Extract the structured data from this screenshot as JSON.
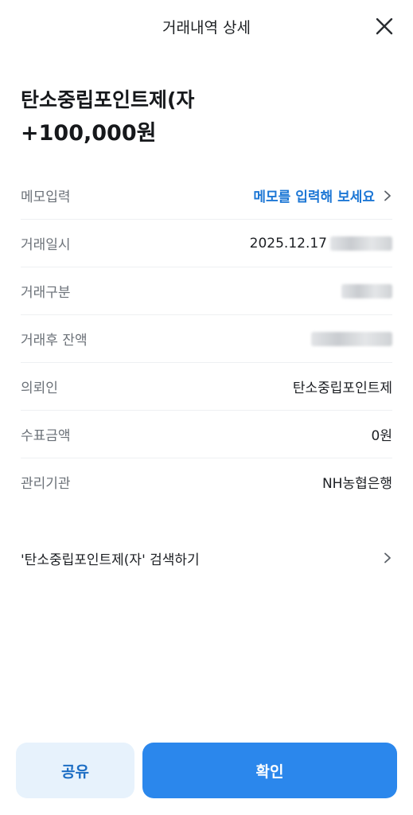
{
  "header": {
    "title": "거래내역 상세",
    "close_icon": "close-icon"
  },
  "summary": {
    "name": "탄소중립포인트제(자",
    "amount": "+100,000원"
  },
  "details": {
    "memo": {
      "label": "메모입력",
      "value": "메모를 입력해 보세요"
    },
    "date": {
      "label": "거래일시",
      "value": "2025.12.17"
    },
    "type": {
      "label": "거래구분"
    },
    "balance": {
      "label": "거래후 잔액"
    },
    "requester": {
      "label": "의뢰인",
      "value": "탄소중립포인트제"
    },
    "fee": {
      "label": "수표금액",
      "value": "0원"
    },
    "institution": {
      "label": "관리기관",
      "value": "NH농협은행"
    }
  },
  "search": {
    "label": "'탄소중립포인트제(자' 검색하기"
  },
  "buttons": {
    "share": "공유",
    "confirm": "확인"
  },
  "colors": {
    "accent": "#2b87ec",
    "link": "#1d77d5",
    "share_bg": "#e7f2fc"
  }
}
